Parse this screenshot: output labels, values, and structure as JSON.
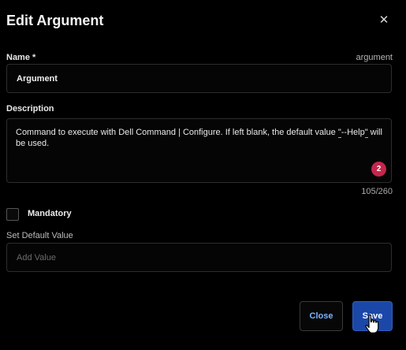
{
  "dialog": {
    "title": "Edit Argument",
    "close_icon": "close-icon"
  },
  "name_field": {
    "label": "Name *",
    "hint": "argument",
    "value": "Argument"
  },
  "description_field": {
    "label": "Description",
    "text_before": "Command to execute with Dell Command | Configure. If left blank, the default value ",
    "squiggle_1": "\"",
    "squiggle_middle": "--Help",
    "squiggle_2": "\"",
    "text_after": " will be used.",
    "error_count": "2",
    "counter": "105/260"
  },
  "mandatory": {
    "label": "Mandatory",
    "checked": false
  },
  "default_value": {
    "label": "Set Default Value",
    "placeholder": "Add Value",
    "value": ""
  },
  "footer": {
    "close_label": "Close",
    "save_label": "Save"
  },
  "colors": {
    "background": "#000000",
    "border": "#2d2d2d",
    "primary": "#1b48a8",
    "link": "#7db3ff",
    "error": "#c4264c",
    "spellcheck": "#d8a04a"
  }
}
